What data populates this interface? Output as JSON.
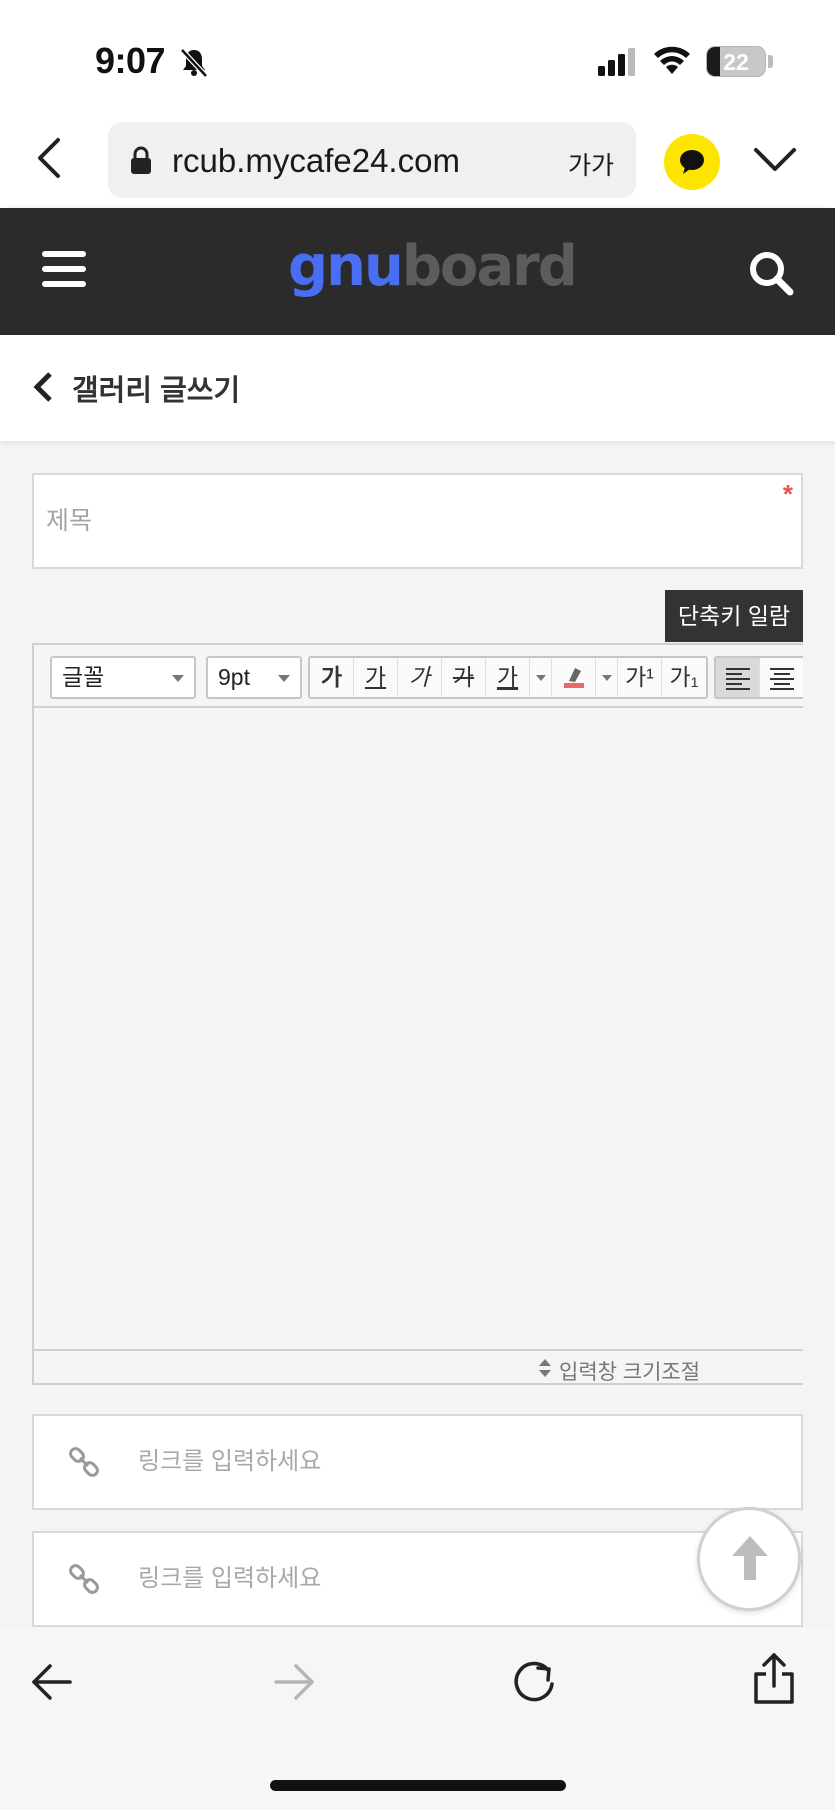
{
  "status_bar": {
    "time": "9:07",
    "battery": "22",
    "battery_level": 0.22
  },
  "browser": {
    "url": "rcub.mycafe24.com",
    "text_size_label": "가가"
  },
  "site": {
    "logo_part1": "gnu",
    "logo_part2": "board"
  },
  "page": {
    "title": "갤러리 글쓰기"
  },
  "form": {
    "subject_placeholder": "제목",
    "required_mark": "*",
    "shortcut_button": "단축키 일람",
    "link_placeholder_1": "링크를 입력하세요",
    "link_placeholder_2": "링크를 입력하세요"
  },
  "editor": {
    "font_select": "글꼴",
    "size_select": "9pt",
    "format_buttons": [
      "가",
      "가",
      "가",
      "가",
      "가"
    ],
    "superscript": "가¹",
    "subscript": "가₁",
    "resize_label": "입력창 크기조절"
  },
  "icons": {
    "bell": "bell-slash-icon",
    "signal": "cellular-signal-icon",
    "wifi": "wifi-icon",
    "lock": "lock-icon",
    "chat": "kakao-chat-icon",
    "menu": "hamburger-menu-icon",
    "search": "search-icon",
    "link": "link-icon",
    "top": "arrow-up-icon"
  },
  "colors": {
    "header_bg": "#2b2b2b",
    "logo_accent": "#4a6ef2",
    "kakao_yellow": "#fde500",
    "required": "#ee5050"
  }
}
